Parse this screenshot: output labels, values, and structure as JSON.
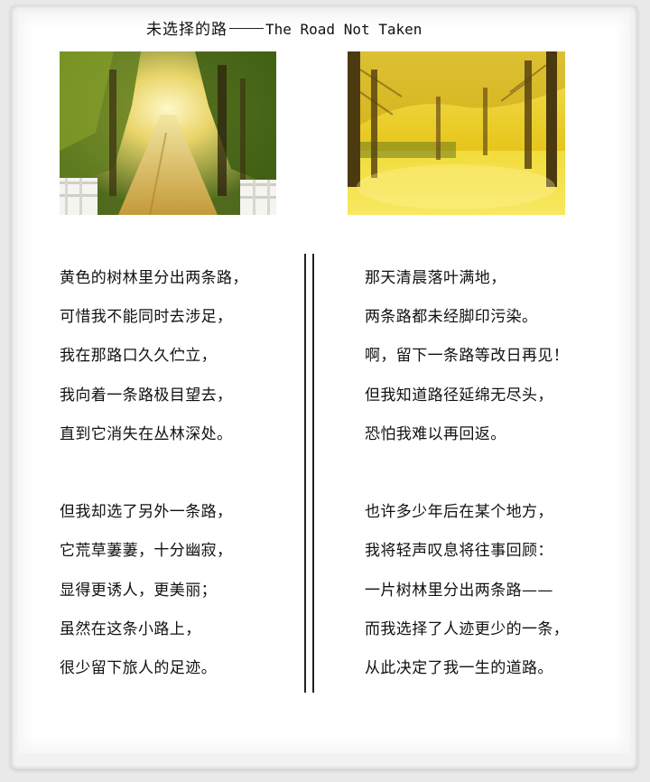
{
  "title": {
    "zh": "未选择的路",
    "en": "The Road Not Taken"
  },
  "images": [
    {
      "name": "forest-road-photo"
    },
    {
      "name": "golden-ginkgo-path-photo"
    }
  ],
  "poem": {
    "left": {
      "stanza1": [
        "黄色的树林里分出两条路，",
        "可惜我不能同时去涉足，",
        "我在那路口久久伫立，",
        "我向着一条路极目望去，",
        "直到它消失在丛林深处。"
      ],
      "stanza2": [
        "但我却选了另外一条路，",
        "它荒草萋萋，十分幽寂，",
        "显得更诱人，更美丽；",
        "虽然在这条小路上，",
        "很少留下旅人的足迹。"
      ]
    },
    "right": {
      "stanza1": [
        "那天清晨落叶满地，",
        "两条路都未经脚印污染。",
        "啊，留下一条路等改日再见！",
        "但我知道路径延绵无尽头，",
        "恐怕我难以再回返。"
      ],
      "stanza2": [
        "也许多少年后在某个地方，",
        "我将轻声叹息将往事回顾：",
        "一片树林里分出两条路——",
        "而我选择了人迹更少的一条，",
        "从此决定了我一生的道路。"
      ]
    }
  }
}
